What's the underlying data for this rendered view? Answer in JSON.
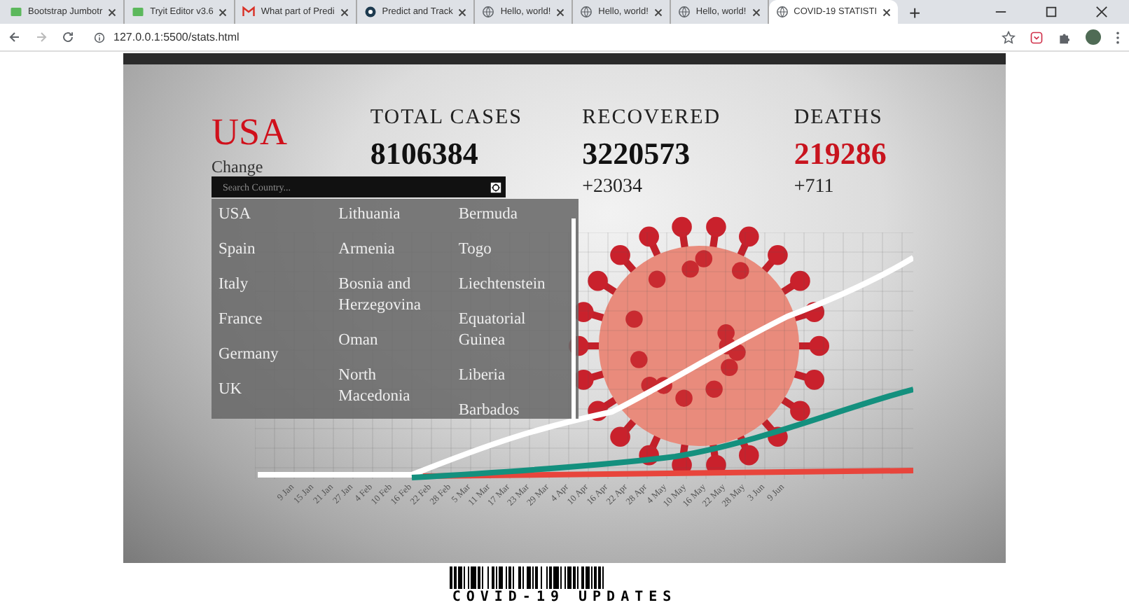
{
  "browser": {
    "tabs": [
      {
        "title": "Bootstrap Jumbotr",
        "kind": "w3",
        "selected": false
      },
      {
        "title": "Tryit Editor v3.6",
        "kind": "w3",
        "selected": false
      },
      {
        "title": "What part of Predi",
        "kind": "mail",
        "selected": false
      },
      {
        "title": "Predict and Track",
        "kind": "disc",
        "selected": false
      },
      {
        "title": "Hello, world!",
        "kind": "globe",
        "selected": false
      },
      {
        "title": "Hello, world!",
        "kind": "globe",
        "selected": false
      },
      {
        "title": "Hello, world!",
        "kind": "globe",
        "selected": false
      },
      {
        "title": "COVID-19 STATISTI",
        "kind": "globe",
        "selected": true
      }
    ],
    "new_tab": "+",
    "address": "127.0.0.1:5500/stats.html"
  },
  "page": {
    "country": {
      "name": "USA",
      "action": "Change"
    },
    "stats": [
      {
        "label": "TOTAL CASES",
        "value": "8106384",
        "color": "#111111"
      },
      {
        "label": "RECOVERED",
        "value": "3220573",
        "change": "+23034",
        "color": "#111111"
      },
      {
        "label": "DEATHS",
        "value": "219286",
        "change": "+711",
        "color": "#c8141e"
      }
    ],
    "search": {
      "placeholder": "Search Country..."
    },
    "country_menu": {
      "columns": [
        {
          "items": [
            "USA",
            "Spain",
            "Italy",
            "France",
            "Germany",
            "UK"
          ]
        },
        {
          "items": [
            "Lithuania",
            "Armenia",
            "Bosnia and Herzegovina",
            "Oman",
            "North Macedonia"
          ]
        },
        {
          "items": [
            "Bermuda",
            "Togo",
            "Liechtenstein",
            "Equatorial Guinea",
            "Liberia",
            "Barbados"
          ]
        }
      ]
    },
    "chart": {
      "date_labels": [
        "9 Jan",
        "15 Jan",
        "21 Jan",
        "27 Jan",
        "4 Feb",
        "10 Feb",
        "16 Feb",
        "22 Feb",
        "28 Feb",
        "5 Mar",
        "11 Mar",
        "17 Mar",
        "23 Mar",
        "29 Mar",
        "4 Apr",
        "10 Apr",
        "16 Apr",
        "22 Apr",
        "28 Apr",
        "4 May",
        "10 May",
        "16 May",
        "22 May",
        "28 May",
        "3 Jun",
        "9 Jun"
      ]
    },
    "footer": {
      "title": "COVID-19 UPDATES"
    }
  }
}
